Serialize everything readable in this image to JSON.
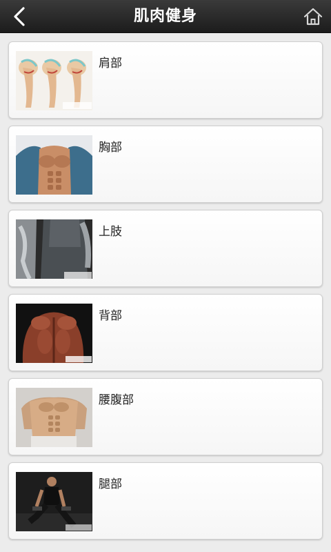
{
  "header": {
    "title": "肌肉健身",
    "back_icon": "chevron-left-icon",
    "home_icon": "home-icon"
  },
  "categories": [
    {
      "label": "肩部",
      "image": "shoulder-anatomy-illustration"
    },
    {
      "label": "胸部",
      "image": "chest-muscles-photo"
    },
    {
      "label": "上肢",
      "image": "arm-muscles-photo"
    },
    {
      "label": "背部",
      "image": "back-muscles-photo"
    },
    {
      "label": "腰腹部",
      "image": "abdominal-muscles-photo"
    },
    {
      "label": "腿部",
      "image": "leg-workout-photo"
    }
  ],
  "colors": {
    "header_bg": "#2a2a2a",
    "header_text": "#ffffff",
    "page_bg": "#ececec",
    "card_bg": "#ffffff",
    "label_text": "#222222"
  }
}
